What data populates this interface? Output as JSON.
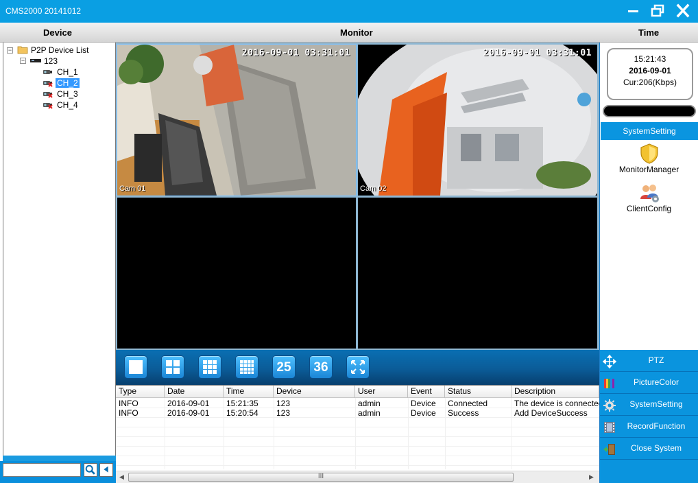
{
  "window": {
    "title": "CMS2000 20141012",
    "minimize_icon": "minimize-icon",
    "restore_icon": "restore-icon",
    "close_icon": "close-icon"
  },
  "headers": {
    "device": "Device",
    "monitor": "Monitor",
    "time": "Time"
  },
  "tree": {
    "root": "P2P Device List",
    "device": "123",
    "channels": [
      {
        "label": "CH_1",
        "status": "online",
        "selected": false
      },
      {
        "label": "CH_2",
        "status": "offline",
        "selected": true
      },
      {
        "label": "CH_3",
        "status": "offline",
        "selected": false
      },
      {
        "label": "CH_4",
        "status": "offline",
        "selected": false
      }
    ]
  },
  "search": {
    "value": "",
    "search_icon": "search-icon",
    "back_icon": "arrow-left-icon"
  },
  "monitor": {
    "cells": [
      {
        "timestamp": "2016-09-01 03:31:01",
        "camera": "Cam 01"
      },
      {
        "timestamp": "2016-09-01 03:31:01",
        "camera": "Cam 02"
      },
      {
        "timestamp": "",
        "camera": ""
      },
      {
        "timestamp": "",
        "camera": ""
      }
    ],
    "layouts": [
      {
        "name": "layout-1",
        "label": ""
      },
      {
        "name": "layout-4",
        "label": ""
      },
      {
        "name": "layout-9",
        "label": ""
      },
      {
        "name": "layout-16",
        "label": ""
      },
      {
        "name": "layout-25",
        "label": "25"
      },
      {
        "name": "layout-36",
        "label": "36"
      },
      {
        "name": "fullscreen",
        "label": ""
      }
    ]
  },
  "log": {
    "columns": [
      "Type",
      "Date",
      "Time",
      "Device",
      "User",
      "Event",
      "Status",
      "Description"
    ],
    "rows": [
      [
        "INFO",
        "2016-09-01",
        "15:21:35",
        "123",
        "admin",
        "Device",
        "Connected",
        "The device is connected."
      ],
      [
        "INFO",
        "2016-09-01",
        "15:20:54",
        "123",
        "admin",
        "Device",
        "Success",
        "Add DeviceSuccess"
      ]
    ],
    "scroll_grip": "III"
  },
  "clock": {
    "time": "15:21:43",
    "date": "2016-09-01",
    "bitrate": "Cur:206(Kbps)"
  },
  "system_setting": {
    "header": "SystemSetting",
    "tools": [
      {
        "label": "MonitorManager",
        "icon": "shield-icon"
      },
      {
        "label": "ClientConfig",
        "icon": "users-gear-icon"
      }
    ]
  },
  "functions": [
    {
      "label": "PTZ",
      "icon": "move-arrows-icon"
    },
    {
      "label": "PictureColor",
      "icon": "color-palette-icon"
    },
    {
      "label": "SystemSetting",
      "icon": "gear-icon"
    },
    {
      "label": "RecordFunction",
      "icon": "film-icon"
    },
    {
      "label": "Close System",
      "icon": "exit-door-icon"
    }
  ],
  "colors": {
    "accent": "#0a9fe3",
    "toolbar_dark": "#0b5c98",
    "selection": "#3399ff"
  }
}
